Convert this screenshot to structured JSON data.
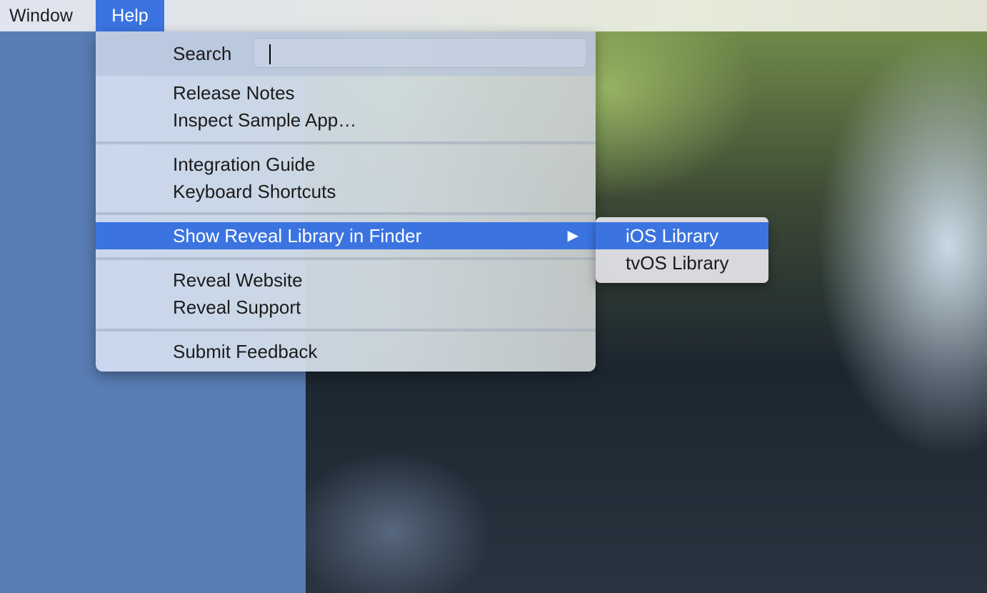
{
  "menubar": {
    "items": [
      {
        "label": "Window"
      },
      {
        "label": "Help"
      }
    ]
  },
  "help_menu": {
    "search_label": "Search",
    "search_value": "",
    "items": [
      {
        "label": "Release Notes"
      },
      {
        "label": "Inspect Sample App…"
      },
      {
        "label": "Integration Guide"
      },
      {
        "label": "Keyboard Shortcuts"
      },
      {
        "label": "Show Reveal Library in Finder",
        "submenu_indicator": "▶"
      },
      {
        "label": "Reveal Website"
      },
      {
        "label": "Reveal Support"
      },
      {
        "label": "Submit Feedback"
      }
    ]
  },
  "submenu": {
    "items": [
      {
        "label": "iOS Library"
      },
      {
        "label": "tvOS Library"
      }
    ]
  },
  "colors": {
    "selection": "#3b74e1",
    "desktop": "#587db4"
  },
  "icons": {
    "submenu_arrow": "triangle-right-icon"
  }
}
